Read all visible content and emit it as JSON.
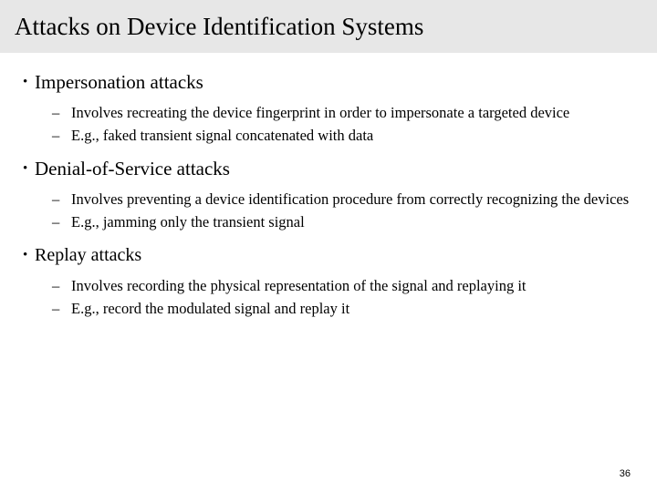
{
  "slide": {
    "title": "Attacks on Device Identification Systems",
    "page_number": "36",
    "header_bg_color": "#e7e7e7",
    "text_color": "#000000",
    "background_color": "#ffffff",
    "bullet_marker": "•",
    "sub_bullet_marker": "–",
    "sections": [
      {
        "heading": "Impersonation attacks",
        "points": [
          "Involves recreating the device fingerprint in order to impersonate a targeted device",
          "E.g., faked transient signal concatenated with data"
        ]
      },
      {
        "heading": "Denial-of-Service attacks",
        "points": [
          "Involves preventing a device identification procedure from correctly recognizing the devices",
          "E.g., jamming only the transient signal"
        ]
      },
      {
        "heading": "Replay attacks",
        "points": [
          "Involves recording the physical representation of the signal and replaying it",
          "E.g., record the modulated signal and replay it"
        ]
      }
    ]
  }
}
